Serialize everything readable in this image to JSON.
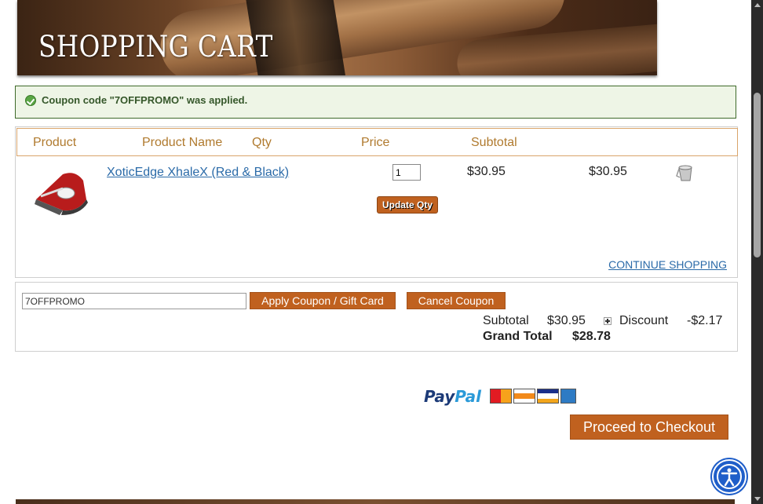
{
  "banner": {
    "title": "SHOPPING CART"
  },
  "alert": {
    "message": "Coupon code \"7OFFPROMO\" was applied.",
    "icon": "check-circle-icon"
  },
  "cart": {
    "headers": {
      "product": "Product",
      "product_name": "Product Name",
      "qty": "Qty",
      "price": "Price",
      "subtotal": "Subtotal"
    },
    "items": [
      {
        "name": "XoticEdge XhaleX (Red & Black)",
        "qty": "1",
        "price": "$30.95",
        "subtotal": "$30.95"
      }
    ],
    "update_label": "Update Qty",
    "continue_label": "CONTINUE SHOPPING"
  },
  "coupon": {
    "value": "7OFFPROMO",
    "apply_label": "Apply Coupon / Gift Card",
    "cancel_label": "Cancel Coupon"
  },
  "totals": {
    "subtotal_label": "Subtotal",
    "subtotal_value": "$30.95",
    "discount_label": "Discount",
    "discount_value": "-$2.17",
    "grand_label": "Grand Total",
    "grand_value": "$28.78"
  },
  "payment": {
    "paypal_part1": "Pay",
    "paypal_part2": "Pal"
  },
  "checkout": {
    "label": "Proceed to Checkout"
  },
  "colors": {
    "accent": "#c0611f",
    "header_text": "#b07a2e",
    "link": "#2a6aa8",
    "success_bg": "#eef5e6"
  }
}
